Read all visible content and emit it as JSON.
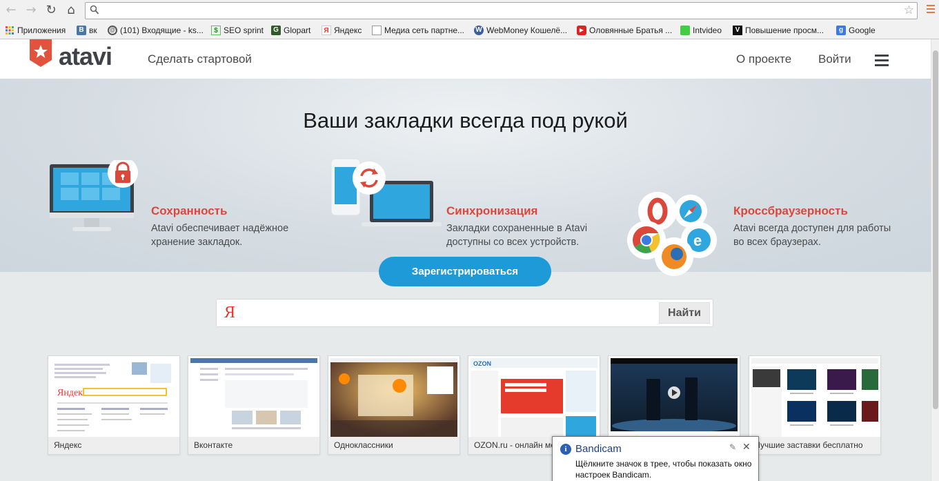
{
  "browser": {
    "address_value": "",
    "bookmarks": [
      {
        "label": "Приложения",
        "icon": "apps-grid-icon",
        "color": "#e44"
      },
      {
        "label": "вк",
        "icon": "vk-icon",
        "color": "#4a76a8"
      },
      {
        "label": "(101) Входящие - ks...",
        "icon": "mail-icon",
        "color": "#666"
      },
      {
        "label": "SEO sprint",
        "icon": "seosprint-icon",
        "color": "#3a9a3a"
      },
      {
        "label": "Glopart",
        "icon": "glopart-icon",
        "color": "#3a6a2a"
      },
      {
        "label": "Яндекс",
        "icon": "yandex-icon",
        "color": "#e53b2c"
      },
      {
        "label": "Медиа сеть партне...",
        "icon": "page-icon",
        "color": "#999"
      },
      {
        "label": "WebMoney Кошелё...",
        "icon": "webmoney-icon",
        "color": "#3a5fa0"
      },
      {
        "label": "Оловянные Братья ...",
        "icon": "youtube-icon",
        "color": "#d22"
      },
      {
        "label": "Intvideo",
        "icon": "intvideo-icon",
        "color": "#4c4"
      },
      {
        "label": "Повышение просм...",
        "icon": "v-icon",
        "color": "#111"
      },
      {
        "label": "Google",
        "icon": "google-icon",
        "color": "#3b7be0"
      }
    ]
  },
  "site": {
    "logo_text": "atavi",
    "make_start": "Сделать стартовой",
    "about": "О проекте",
    "login": "Войти"
  },
  "hero": {
    "title": "Ваши закладки всегда под рукой",
    "features": [
      {
        "title": "Сохранность",
        "text": "Atavi обеспечивает надёжное хранение закладок."
      },
      {
        "title": "Синхронизация",
        "text": "Закладки сохраненные в Atavi доступны со всех устройств."
      },
      {
        "title": "Кроссбраузерность",
        "text": "Atavi всегда доступен для работы во всех браузерах."
      }
    ]
  },
  "register_label": "Зарегистрироваться",
  "search": {
    "logo": "Я",
    "value": "",
    "button": "Найти"
  },
  "tiles": [
    {
      "caption": "Яндекс"
    },
    {
      "caption": "Вконтакте"
    },
    {
      "caption": "Одноклассники"
    },
    {
      "caption": "OZON.ru - онлайн ме"
    },
    {
      "caption": ""
    },
    {
      "caption": "Лучшие заставки бесплатно"
    }
  ],
  "notification": {
    "title": "Bandicam",
    "text": "Щёлкните значок в трее, чтобы показать окно настроек Bandicam."
  },
  "colors": {
    "accent_red": "#d9483b",
    "accent_blue": "#1f9ad9"
  }
}
